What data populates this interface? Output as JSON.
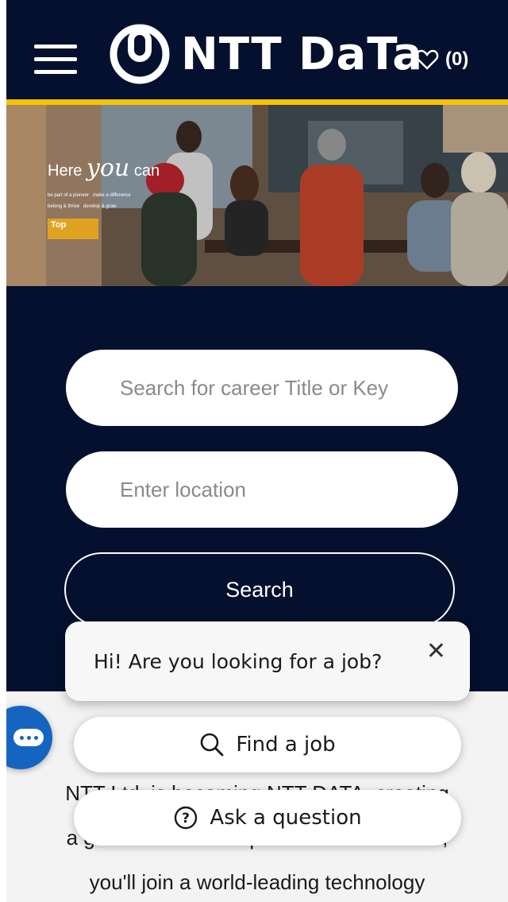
{
  "header": {
    "brand": "NTT DaTa",
    "favorites_count": "(0)"
  },
  "hero": {
    "tagline_prefix": "Here",
    "tagline_accent": "you",
    "tagline_suffix": "can",
    "bullets": [
      "be part of a pioneer",
      "make a difference",
      "belong & thrive",
      "develop & grow"
    ],
    "badge": "Top"
  },
  "search": {
    "keyword_placeholder": "Search for career Title or Key",
    "location_placeholder": "Enter location",
    "button_label": "Search"
  },
  "chat": {
    "greeting": "Hi! Are you looking for a job?",
    "close_symbol": "✕",
    "find_job_label": "Find a job",
    "ask_question_label": "Ask a question"
  },
  "content": {
    "lines": [
      "NTT Ltd. is becoming NTT DATA, creating",
      "a global IT services powerhouse. With us,",
      "you'll join a world-leading technology"
    ]
  },
  "colors": {
    "navy": "#05102e",
    "accent_yellow": "#f5c400",
    "chat_blue": "#1565c0"
  }
}
